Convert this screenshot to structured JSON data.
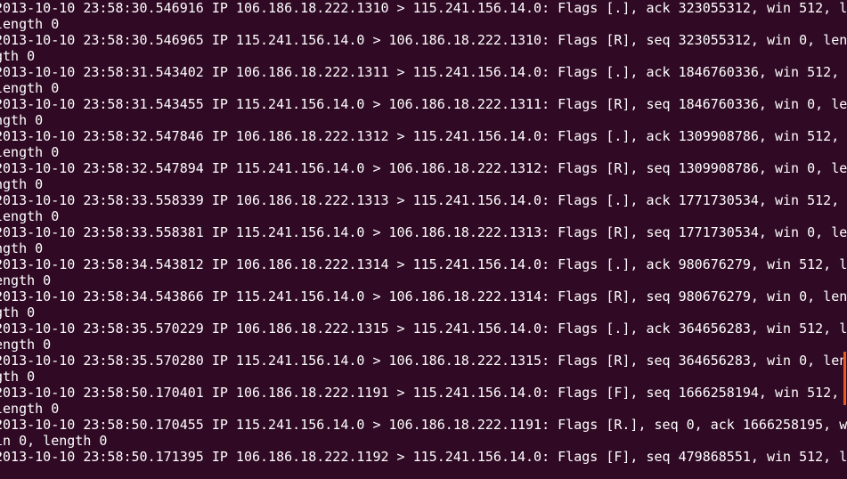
{
  "terminal": {
    "background": "#300a24",
    "foreground": "#ffffff",
    "scroll_marker_color": "#e9581f",
    "lines": [
      "2013-10-10 23:58:30.546916 IP 106.186.18.222.1310 > 115.241.156.14.0: Flags [.], ack 323055312, win 512, l",
      "length 0",
      "2013-10-10 23:58:30.546965 IP 115.241.156.14.0 > 106.186.18.222.1310: Flags [R], seq 323055312, win 0, len",
      "gth 0",
      "2013-10-10 23:58:31.543402 IP 106.186.18.222.1311 > 115.241.156.14.0: Flags [.], ack 1846760336, win 512,",
      "length 0",
      "2013-10-10 23:58:31.543455 IP 115.241.156.14.0 > 106.186.18.222.1311: Flags [R], seq 1846760336, win 0, le",
      "ngth 0",
      "2013-10-10 23:58:32.547846 IP 106.186.18.222.1312 > 115.241.156.14.0: Flags [.], ack 1309908786, win 512,",
      "length 0",
      "2013-10-10 23:58:32.547894 IP 115.241.156.14.0 > 106.186.18.222.1312: Flags [R], seq 1309908786, win 0, le",
      "ngth 0",
      "2013-10-10 23:58:33.558339 IP 106.186.18.222.1313 > 115.241.156.14.0: Flags [.], ack 1771730534, win 512,",
      "length 0",
      "2013-10-10 23:58:33.558381 IP 115.241.156.14.0 > 106.186.18.222.1313: Flags [R], seq 1771730534, win 0, le",
      "ngth 0",
      "2013-10-10 23:58:34.543812 IP 106.186.18.222.1314 > 115.241.156.14.0: Flags [.], ack 980676279, win 512, l",
      "ength 0",
      "2013-10-10 23:58:34.543866 IP 115.241.156.14.0 > 106.186.18.222.1314: Flags [R], seq 980676279, win 0, len",
      "gth 0",
      "2013-10-10 23:58:35.570229 IP 106.186.18.222.1315 > 115.241.156.14.0: Flags [.], ack 364656283, win 512, l",
      "ength 0",
      "2013-10-10 23:58:35.570280 IP 115.241.156.14.0 > 106.186.18.222.1315: Flags [R], seq 364656283, win 0, len",
      "gth 0",
      "2013-10-10 23:58:50.170401 IP 106.186.18.222.1191 > 115.241.156.14.0: Flags [F], seq 1666258194, win 512,",
      "length 0",
      "2013-10-10 23:58:50.170455 IP 115.241.156.14.0 > 106.186.18.222.1191: Flags [R.], seq 0, ack 1666258195, w",
      "in 0, length 0",
      "2013-10-10 23:58:50.171395 IP 106.186.18.222.1192 > 115.241.156.14.0: Flags [F], seq 479868551, win 512, l"
    ]
  }
}
